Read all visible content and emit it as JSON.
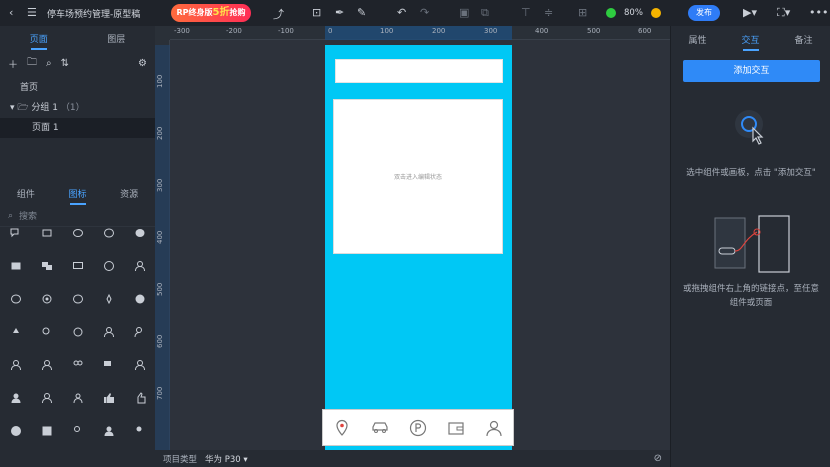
{
  "app": {
    "title": "停车场预约管理-原型稿",
    "promo_prefix": "RP终身版",
    "promo_highlight": "5折",
    "promo_suffix": "抢购",
    "zoom": "80%",
    "publish_label": "发布"
  },
  "left_panel": {
    "tabs": [
      "页面",
      "图层"
    ],
    "active_tab": "页面",
    "tree": [
      {
        "label": "首页"
      },
      {
        "label": "分组 1",
        "count": "（1）"
      },
      {
        "label": "页面 1"
      }
    ],
    "lib_tabs": [
      "组件",
      "图标",
      "资源"
    ],
    "active_lib_tab": "图标",
    "search_placeholder": "搜索"
  },
  "ruler": {
    "top_ticks": [
      "-300",
      "-200",
      "-100",
      "0",
      "100",
      "200",
      "300",
      "400",
      "500",
      "600"
    ],
    "left_ticks": [
      "100",
      "200",
      "300",
      "400",
      "500",
      "600",
      "700"
    ]
  },
  "canvas": {
    "card_text": "双击进入编辑状态"
  },
  "bottom_bar": {
    "project_type_label": "项目类型",
    "device": "华为 P30"
  },
  "right_panel": {
    "tabs": [
      "属性",
      "交互",
      "备注"
    ],
    "active_tab": "交互",
    "add_button": "添加交互",
    "hint1": "选中组件或画板，点击 \"添加交互\"",
    "hint2": "或拖拽组件右上角的链接点，至任意组件或页面"
  },
  "colors": {
    "accent": "#2f8af7",
    "phone_bg": "#00c8f5",
    "panel_bg": "#262b33"
  }
}
